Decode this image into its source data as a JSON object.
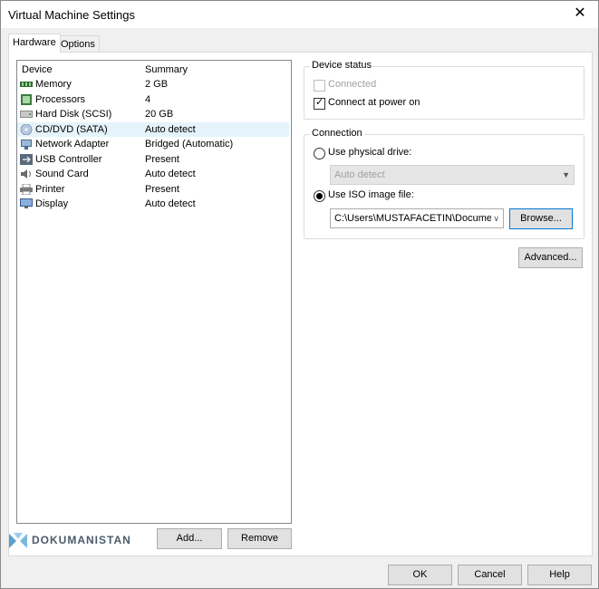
{
  "window": {
    "title": "Virtual Machine Settings",
    "close_glyph": "✕"
  },
  "tabs": [
    {
      "label": "Hardware",
      "active": true
    },
    {
      "label": "Options",
      "active": false
    }
  ],
  "device_list": {
    "headers": {
      "device": "Device",
      "summary": "Summary"
    },
    "rows": [
      {
        "device": "Memory",
        "summary": "2 GB",
        "icon": "memory-icon"
      },
      {
        "device": "Processors",
        "summary": "4",
        "icon": "processor-icon"
      },
      {
        "device": "Hard Disk (SCSI)",
        "summary": "20 GB",
        "icon": "hard-disk-icon"
      },
      {
        "device": "CD/DVD (SATA)",
        "summary": "Auto detect",
        "icon": "cd-dvd-icon",
        "selected": true
      },
      {
        "device": "Network Adapter",
        "summary": "Bridged (Automatic)",
        "icon": "network-adapter-icon"
      },
      {
        "device": "USB Controller",
        "summary": "Present",
        "icon": "usb-icon"
      },
      {
        "device": "Sound Card",
        "summary": "Auto detect",
        "icon": "sound-card-icon"
      },
      {
        "device": "Printer",
        "summary": "Present",
        "icon": "printer-icon"
      },
      {
        "device": "Display",
        "summary": "Auto detect",
        "icon": "display-icon"
      }
    ]
  },
  "device_status": {
    "label": "Device status",
    "connected": {
      "label": "Connected",
      "checked": false,
      "enabled": false
    },
    "connect_at_power_on": {
      "label": "Connect at power on",
      "checked": true,
      "enabled": true
    }
  },
  "connection": {
    "label": "Connection",
    "physical_drive": {
      "label": "Use physical drive:",
      "selected": false
    },
    "physical_drive_value": "Auto detect",
    "iso_image": {
      "label": "Use ISO image file:",
      "selected": true
    },
    "iso_path": "C:\\Users\\MUSTAFACETIN\\Docume",
    "browse_label": "Browse..."
  },
  "advanced_label": "Advanced...",
  "list_buttons": {
    "add": "Add...",
    "remove": "Remove"
  },
  "footer_buttons": {
    "ok": "OK",
    "cancel": "Cancel",
    "help": "Help"
  },
  "watermark": "DOKUMANISTAN",
  "colors": {
    "accent": "#0078d7",
    "selection": "#e5f3fb"
  }
}
